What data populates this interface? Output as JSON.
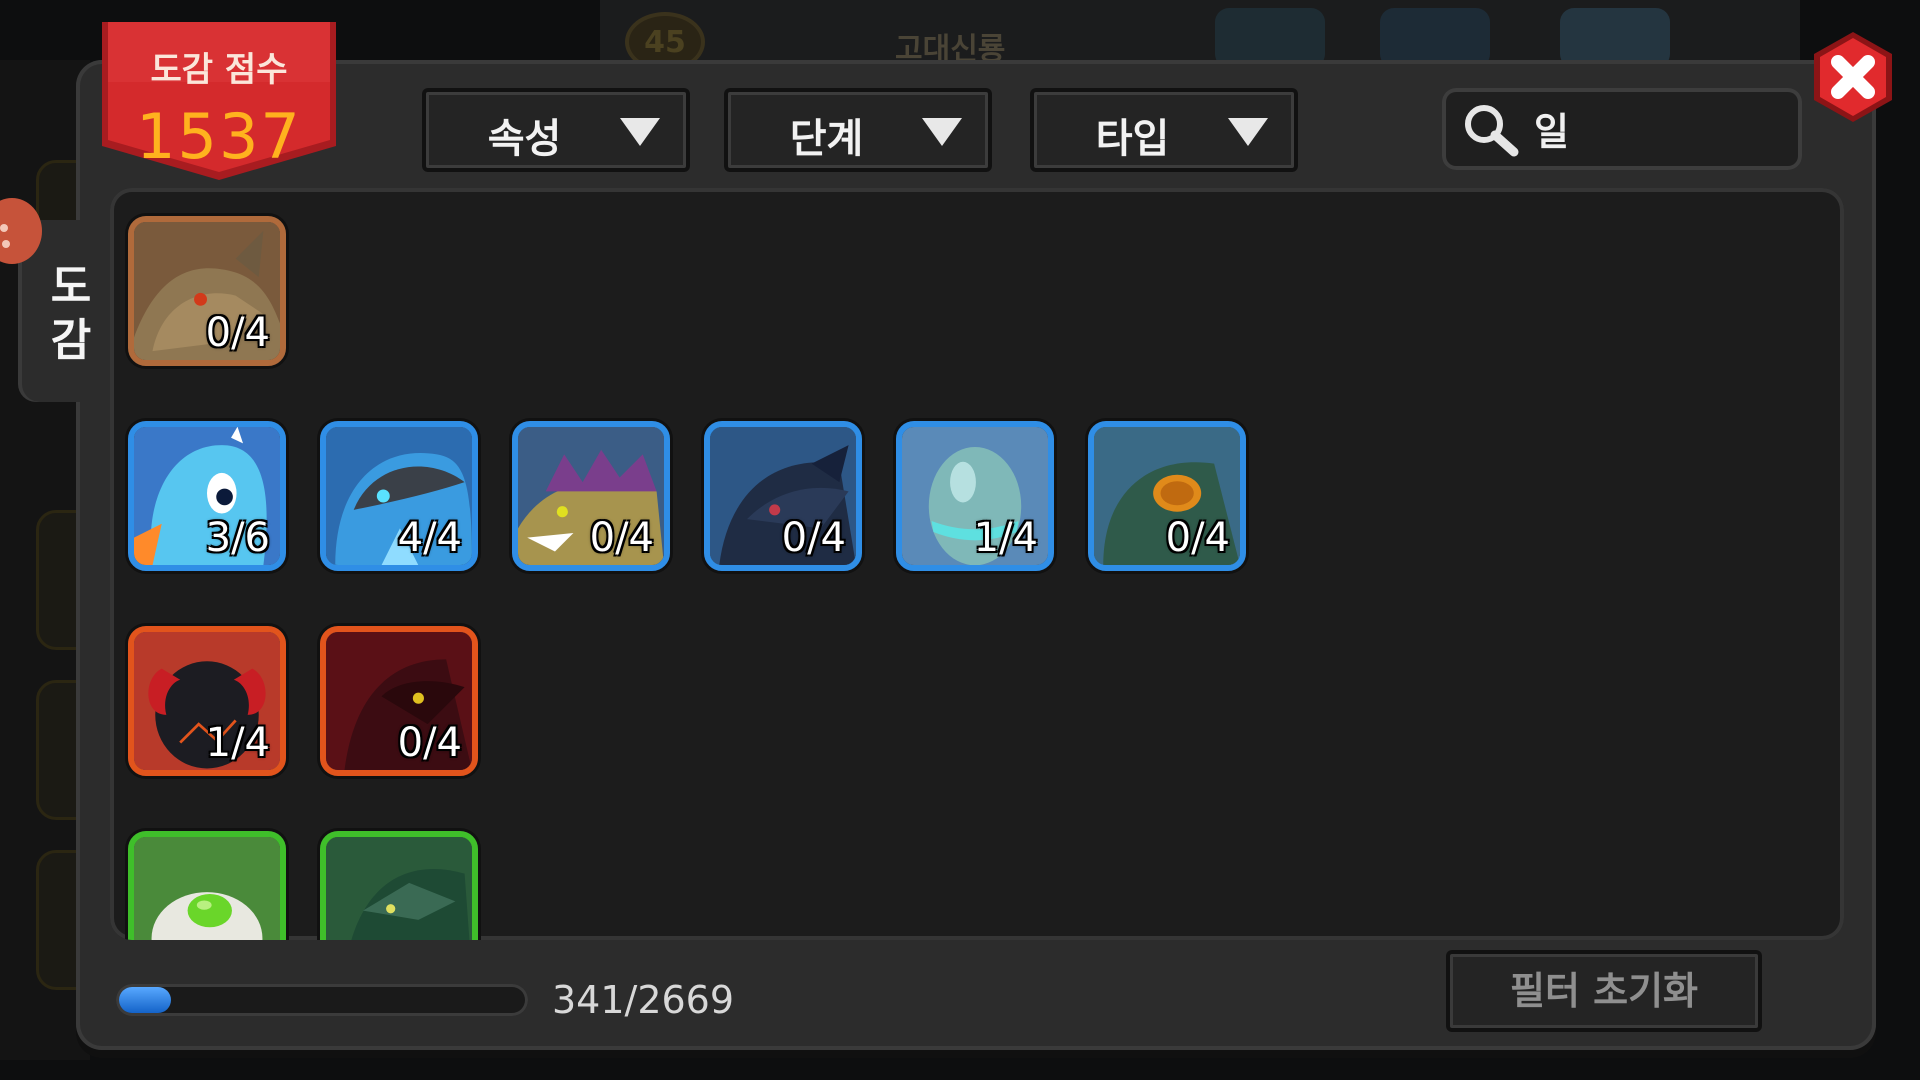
{
  "background": {
    "level": "45",
    "title": "고대신룡"
  },
  "score": {
    "label": "도감 점수",
    "value": "1537"
  },
  "filters": [
    {
      "label": "속성"
    },
    {
      "label": "단계"
    },
    {
      "label": "타입"
    }
  ],
  "search": {
    "value": "일",
    "placeholder": ""
  },
  "side_tab": {
    "label": "도\n감"
  },
  "rows": [
    {
      "frame_color": "#b06a3b",
      "items": [
        {
          "count": "0/4",
          "creature": "earth-dragon"
        }
      ]
    },
    {
      "frame_color": "#2f8ee6",
      "items": [
        {
          "count": "3/6",
          "creature": "blue-dragon"
        },
        {
          "count": "4/4",
          "creature": "water-shark-dragon"
        },
        {
          "count": "0/4",
          "creature": "purple-fin-dragon"
        },
        {
          "count": "0/4",
          "creature": "dark-water-dragon"
        },
        {
          "count": "1/4",
          "creature": "water-egg"
        },
        {
          "count": "0/4",
          "creature": "sea-serpent-egg"
        }
      ]
    },
    {
      "frame_color": "#e2541c",
      "items": [
        {
          "count": "1/4",
          "creature": "fire-horned-egg"
        },
        {
          "count": "0/4",
          "creature": "fire-demon-dragon"
        }
      ]
    },
    {
      "frame_color": "#3fbf2a",
      "items": [
        {
          "count": "",
          "creature": "wind-egg"
        },
        {
          "count": "",
          "creature": "wind-dragon"
        }
      ]
    }
  ],
  "progress": {
    "current": 341,
    "total": 2669,
    "text": "341/2669"
  },
  "reset_button": {
    "label": "필터 초기화"
  },
  "colors": {
    "accent_red": "#d8262a",
    "score_gold": "#ffb21e",
    "progress_blue": "#2b86ee"
  }
}
